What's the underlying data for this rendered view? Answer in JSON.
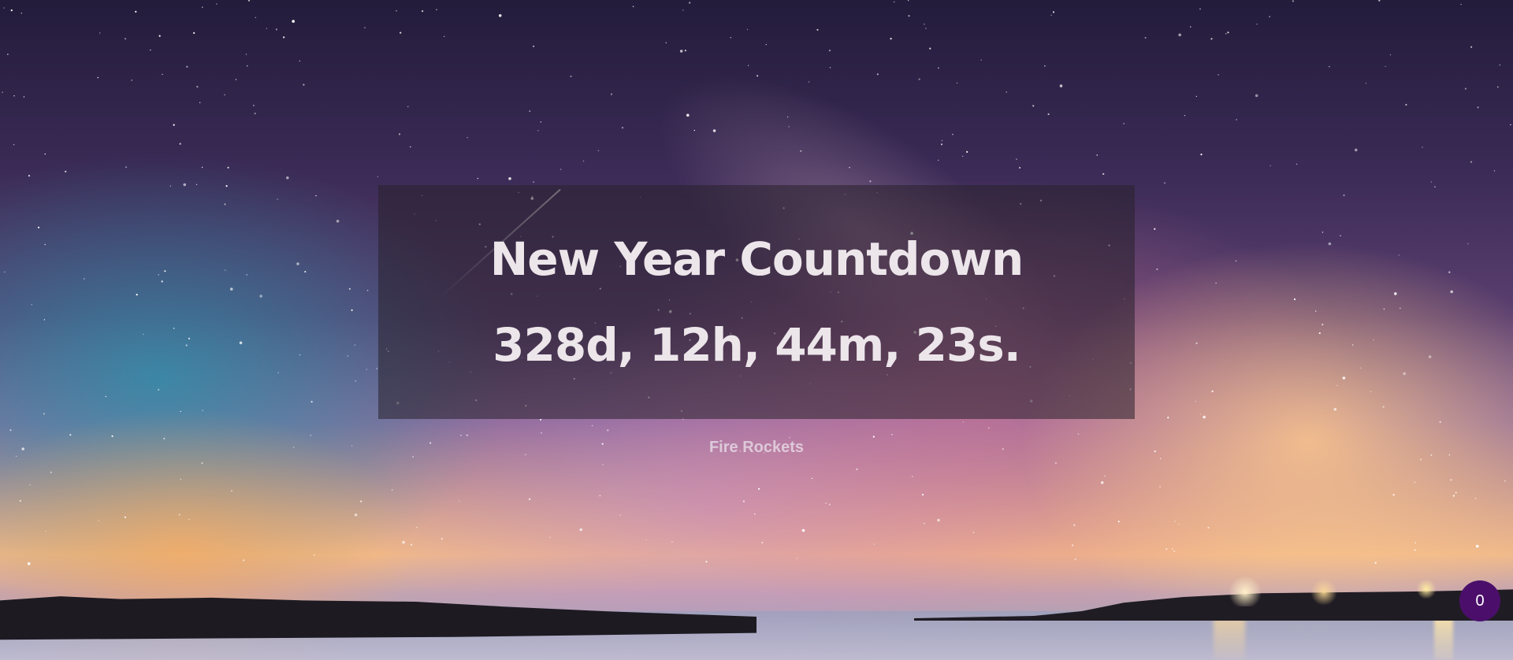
{
  "page": {
    "title": "New Year Countdown",
    "countdown": "328d, 12h, 44m, 23s.",
    "fire_button_label": "Fire Rockets",
    "rocket_count": "0"
  },
  "colors": {
    "panel_background": "#28202c",
    "text": "#ece6ea",
    "badge_background": "#4b0f6b",
    "badge_text": "#ffffff"
  }
}
